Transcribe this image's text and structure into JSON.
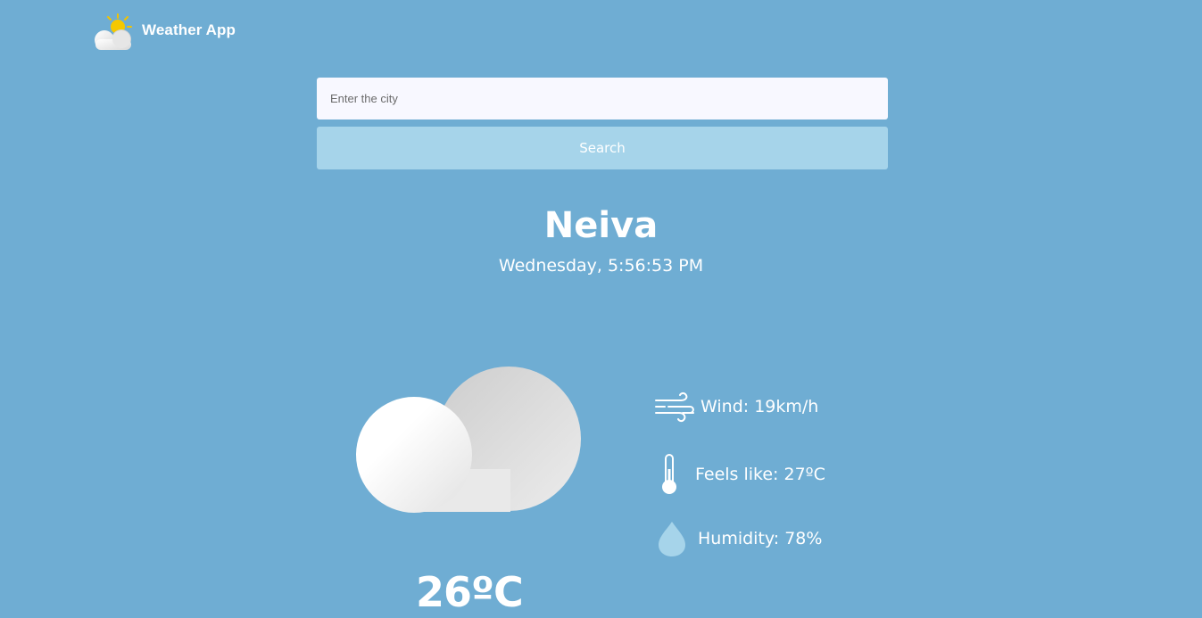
{
  "header": {
    "app_title": "Weather App",
    "logo_icon": "partly-sunny-icon"
  },
  "search": {
    "placeholder": "Enter the city",
    "value": "",
    "button_label": "Search"
  },
  "location": {
    "city": "Neiva",
    "date_time": "Wednesday, 5:56:53 PM"
  },
  "weather": {
    "condition_icon": "cloudy-icon",
    "temperature": "26ºC"
  },
  "details": {
    "wind": {
      "icon": "wind-icon",
      "label": "Wind: 19km/h"
    },
    "feels_like": {
      "icon": "thermometer-icon",
      "label": "Feels like: 27ºC"
    },
    "humidity": {
      "icon": "water-drop-icon",
      "label": "Humidity: 78%"
    }
  },
  "colors": {
    "background": "#6fadd3",
    "input_background": "#f8f8ff",
    "button_background": "#a6d4ea",
    "text": "#ffffff"
  }
}
